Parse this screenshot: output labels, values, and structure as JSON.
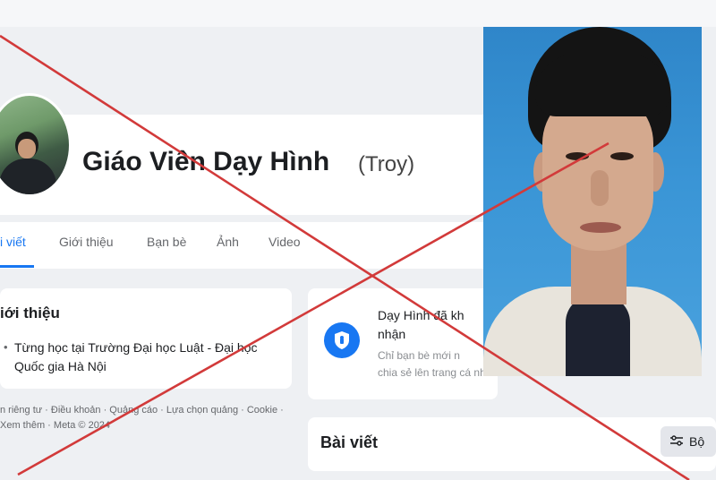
{
  "profile": {
    "name": "Giáo Viên Dạy Hình",
    "alternate_name": "(Troy)"
  },
  "tabs": [
    {
      "label": "i viết",
      "active": true
    },
    {
      "label": "Giới thiệu",
      "active": false
    },
    {
      "label": "Bạn bè",
      "active": false
    },
    {
      "label": "Ảnh",
      "active": false
    },
    {
      "label": "Video",
      "active": false
    }
  ],
  "intro": {
    "title": "iới thiệu",
    "bullet": "•",
    "education_prefix": "Từng học tại ",
    "education_school": "Trường Đại học Luật - Đại học Quốc gia Hà Nội"
  },
  "footer": {
    "links": "n riêng tư · Điều khoản · Quảng cáo · Lựa chọn quảng · Cookie · Xem thêm · Meta © 2024"
  },
  "notice": {
    "title_line1": "Dạy Hình đã kh",
    "title_line2": "nhận",
    "body_line1": "Chỉ bạn bè mới n",
    "body_line2": "chia sẻ lên trang cá nhân"
  },
  "posts": {
    "title": "Bài viết",
    "filter_label": "Bộ",
    "sub_label": "..."
  },
  "colors": {
    "accent": "#1877f2",
    "cross": "#d23a3a",
    "page_bg": "#eef0f3"
  },
  "icons": {
    "shield": "shield-icon",
    "filter": "filter-icon"
  }
}
